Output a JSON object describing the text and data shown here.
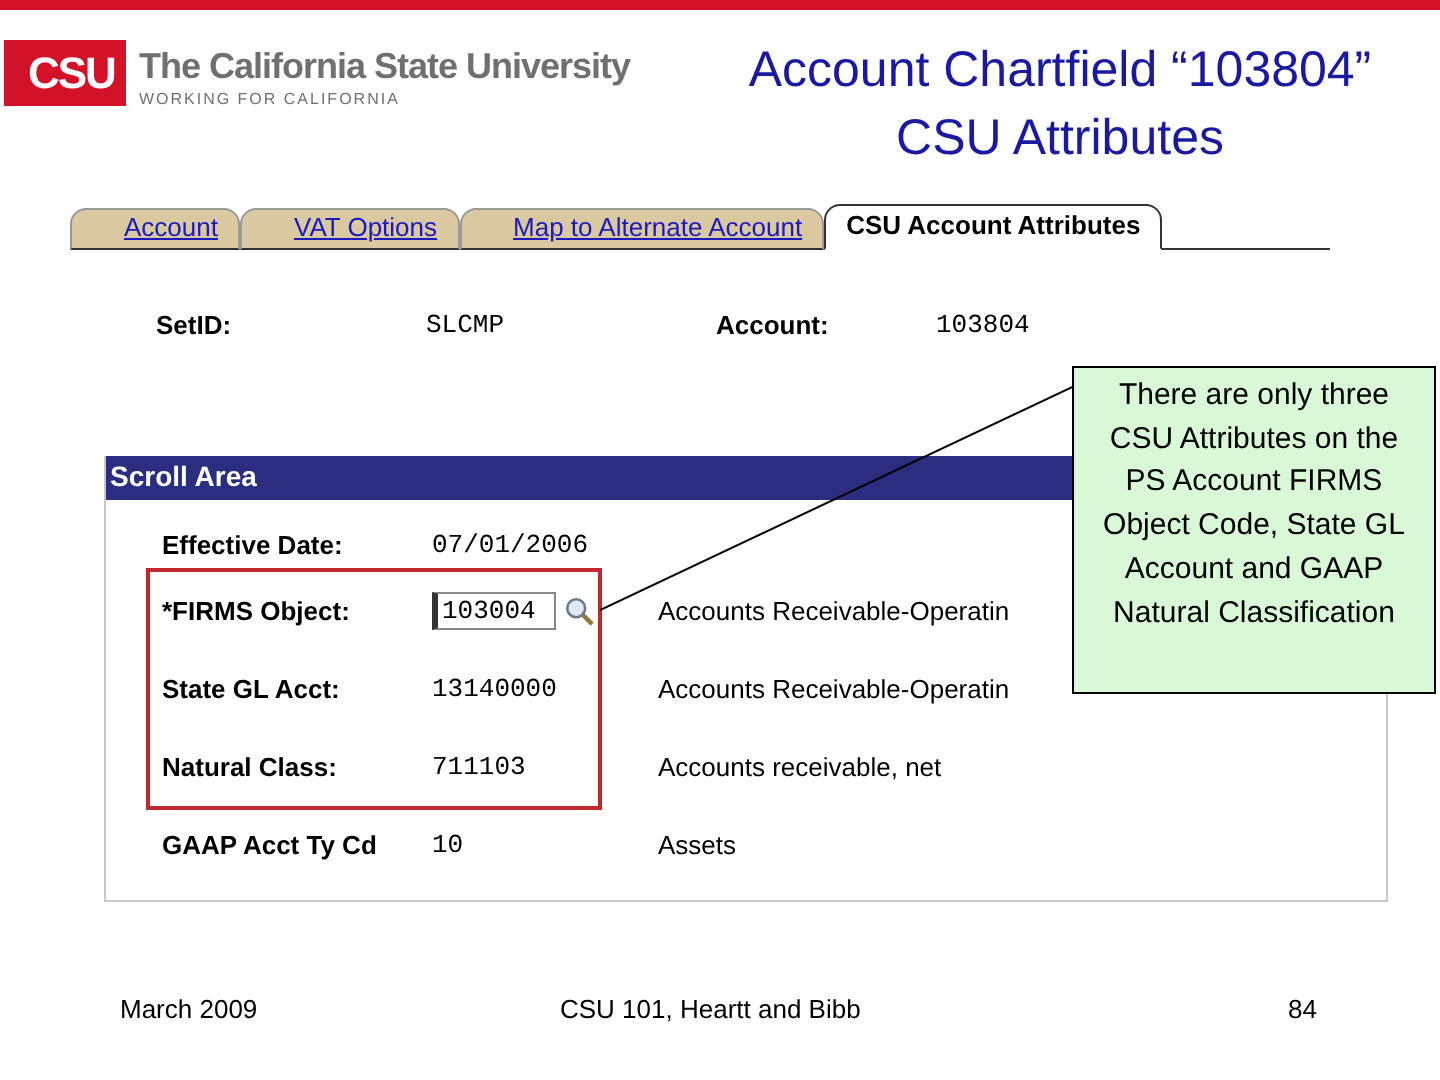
{
  "logo": {
    "mark": "CSU",
    "name": "The California State University",
    "tagline": "WORKING FOR CALIFORNIA"
  },
  "title": [
    "Account Chartfield “103804”",
    "CSU Attributes"
  ],
  "tabs": [
    {
      "label": "Account",
      "selected": false
    },
    {
      "label": "VAT Options",
      "selected": false
    },
    {
      "label": "Map to Alternate Account",
      "selected": false
    },
    {
      "label": "CSU Account Attributes",
      "selected": true
    }
  ],
  "header_fields": [
    {
      "label": "SetID:",
      "value": "SLCMP"
    },
    {
      "label": "Account:",
      "value": "103804"
    }
  ],
  "scroll_area": {
    "title": "Scroll Area",
    "rows": [
      {
        "label": "Effective Date:",
        "value": "07/01/2006",
        "kind": "text",
        "highlighted": false
      },
      {
        "label": "*FIRMS Object:",
        "value": "103004",
        "description": "Accounts Receivable-Operatin",
        "kind": "lookup",
        "highlighted": true
      },
      {
        "label": "State GL Acct:",
        "value": "13140000",
        "description": "Accounts Receivable-Operatin",
        "kind": "text",
        "highlighted": true
      },
      {
        "label": "Natural Class:",
        "value": "711103",
        "description": "Accounts receivable, net",
        "kind": "text",
        "highlighted": true
      },
      {
        "label": "GAAP Acct Ty Cd",
        "value": "10",
        "description": "Assets",
        "kind": "text",
        "highlighted": false
      }
    ]
  },
  "callout": "There are only three CSU Attributes on the PS Account FIRMS Object Code, State GL Account and GAAP Natural Classification",
  "footer": {
    "date": "March 2009",
    "course": "CSU 101, Heartt and Bibb",
    "page": "84"
  }
}
